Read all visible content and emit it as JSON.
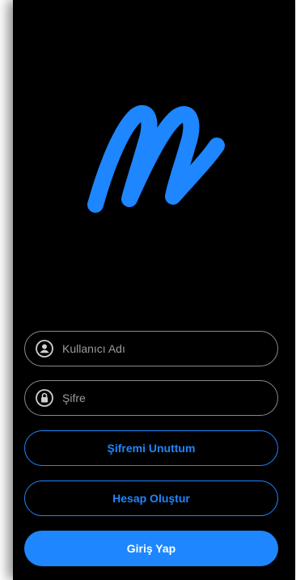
{
  "colors": {
    "accent": "#1e86ff",
    "background": "#000000",
    "field_border": "#8a8a8a",
    "placeholder": "#9b9b9b"
  },
  "logo": {
    "icon": "m-logo-icon"
  },
  "login": {
    "username": {
      "placeholder": "Kullanıcı Adı",
      "icon": "user-icon"
    },
    "password": {
      "placeholder": "Şifre",
      "icon": "lock-icon"
    },
    "forgot_label": "Şifremi Unuttum",
    "register_label": "Hesap Oluştur",
    "submit_label": "Giriş Yap"
  }
}
